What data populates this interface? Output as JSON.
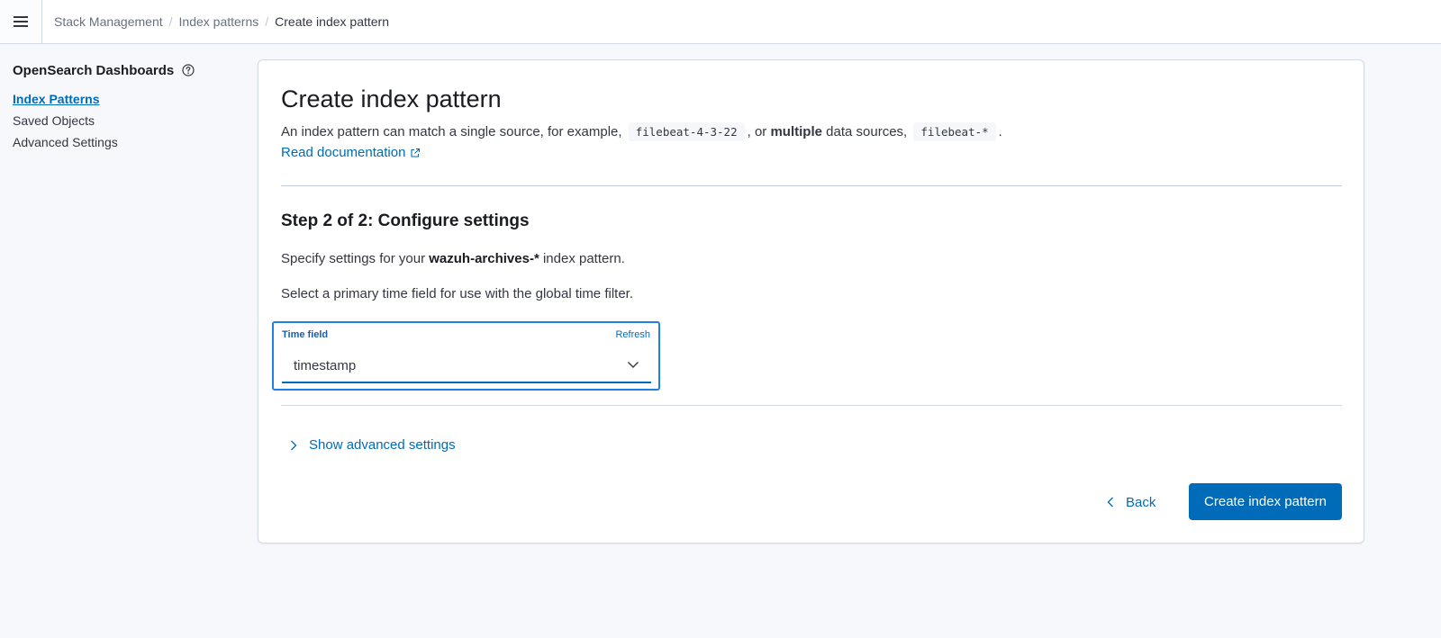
{
  "header": {
    "breadcrumbs": [
      "Stack Management",
      "Index patterns",
      "Create index pattern"
    ]
  },
  "sidebar": {
    "title": "OpenSearch Dashboards",
    "items": [
      {
        "label": "Index Patterns",
        "active": true
      },
      {
        "label": "Saved Objects",
        "active": false
      },
      {
        "label": "Advanced Settings",
        "active": false
      }
    ]
  },
  "main": {
    "title": "Create index pattern",
    "intro": {
      "part1": "An index pattern can match a single source, for example,",
      "code1": "filebeat-4-3-22",
      "part2": ", or",
      "bold": "multiple",
      "part3": "data sources,",
      "code2": "filebeat-*",
      "part4": "."
    },
    "doc_link": "Read documentation",
    "step_title": "Step 2 of 2: Configure settings",
    "specify": {
      "prefix": "Specify settings for your",
      "pattern": "wazuh-archives-*",
      "suffix": "index pattern."
    },
    "select_text": "Select a primary time field for use with the global time filter.",
    "time_field": {
      "label": "Time field",
      "refresh": "Refresh",
      "value": "timestamp"
    },
    "advanced_link": "Show advanced settings",
    "back_label": "Back",
    "create_label": "Create index pattern"
  },
  "colors": {
    "accent": "#006bb8",
    "focus_border": "#1f7fe5",
    "background": "#f7f8fc"
  }
}
